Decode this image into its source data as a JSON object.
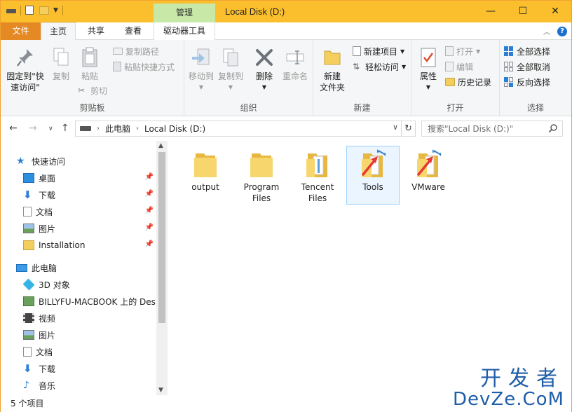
{
  "window": {
    "title": "Local Disk (D:)",
    "context_tab": "管理",
    "controls": {
      "minimize": "—",
      "maximize": "☐",
      "close": "✕"
    }
  },
  "ribbon_tabs": {
    "file": "文件",
    "home": "主页",
    "share": "共享",
    "view": "查看",
    "drive_tools": "驱动器工具"
  },
  "ribbon": {
    "clipboard": {
      "label": "剪贴板",
      "pin_quick_access": "固定到\"快\n速访问\"",
      "copy": "复制",
      "paste": "粘贴",
      "copy_path": "复制路径",
      "paste_shortcut": "粘贴快捷方式",
      "cut": "剪切"
    },
    "organize": {
      "label": "组织",
      "move_to": "移动到",
      "copy_to": "复制到",
      "delete": "删除",
      "rename": "重命名"
    },
    "new": {
      "label": "新建",
      "new_folder": "新建\n文件夹",
      "new_item": "新建项目",
      "easy_access": "轻松访问"
    },
    "open": {
      "label": "打开",
      "properties": "属性",
      "open": "打开",
      "edit": "编辑",
      "history": "历史记录"
    },
    "select": {
      "label": "选择",
      "select_all": "全部选择",
      "select_none": "全部取消",
      "invert": "反向选择"
    }
  },
  "address": {
    "crumbs": [
      "此电脑",
      "Local Disk (D:)"
    ],
    "search_placeholder": "搜索\"Local Disk (D:)\""
  },
  "nav_pane": {
    "quick_access": "快速访问",
    "quick_items": [
      "桌面",
      "下载",
      "文档",
      "图片",
      "Installation"
    ],
    "this_pc": "此电脑",
    "pc_items": [
      "3D 对象",
      "BILLYFU-MACBOOK 上的 Des",
      "视频",
      "图片",
      "文档",
      "下载",
      "音乐"
    ]
  },
  "files": [
    {
      "name": "output",
      "selected": false,
      "shortcut": false
    },
    {
      "name": "Program\nFiles",
      "selected": false,
      "shortcut": false
    },
    {
      "name": "Tencent\nFiles",
      "selected": false,
      "shortcut": false
    },
    {
      "name": "Tools",
      "selected": true,
      "shortcut": true
    },
    {
      "name": "VMware",
      "selected": false,
      "shortcut": true
    }
  ],
  "status": {
    "count": "5 个项目"
  },
  "watermark": {
    "cn": "开发者",
    "en": "DevZe.CoM"
  },
  "colors": {
    "titlebar": "#fbbf2e",
    "file_tab": "#e48924",
    "context_tab": "#c7e8a7",
    "accent": "#1c6fd0",
    "annotation_arrow": "#e53935"
  }
}
